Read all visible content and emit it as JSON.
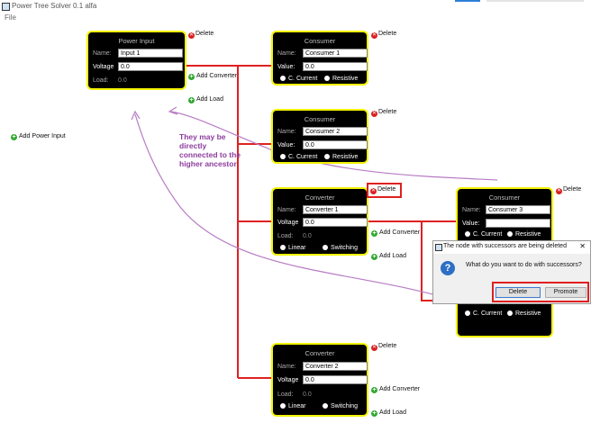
{
  "window": {
    "title": "Power Tree Solver 0.1 alfa"
  },
  "menu": {
    "file": "File"
  },
  "left": {
    "add_power_input": "Add Power Input"
  },
  "power_input": {
    "title": "Power Input",
    "name_label": "Name:",
    "name_value": "Input 1",
    "voltage_label": "Voltage",
    "voltage_value": "0.0",
    "load_label": "Load:",
    "load_value": "0.0",
    "delete": "Delete",
    "add_converter": "Add Converter",
    "add_load": "Add Load"
  },
  "consumer1": {
    "title": "Consumer",
    "name_label": "Name:",
    "name_value": "Consumer 1",
    "value_label": "Value:",
    "value_value": "0.0",
    "opt1": "C. Current",
    "opt2": "Resistive",
    "delete": "Delete"
  },
  "consumer2": {
    "title": "Consumer",
    "name_label": "Name:",
    "name_value": "Consumer 2",
    "value_label": "Value:",
    "value_value": "0.0",
    "opt1": "C. Current",
    "opt2": "Resistive",
    "delete": "Delete"
  },
  "converter1": {
    "title": "Converter",
    "name_label": "Name:",
    "name_value": "Converter 1",
    "voltage_label": "Voltage",
    "voltage_value": "0.0",
    "load_label": "Load:",
    "load_value": "0.0",
    "opt1": "Linear",
    "opt2": "Switching",
    "delete": "Delete",
    "add_converter": "Add Converter",
    "add_load": "Add Load"
  },
  "consumer3": {
    "title": "Consumer",
    "name_label": "Name:",
    "name_value": "Consumer 3",
    "value_label": "Value:",
    "value_value": "",
    "opt1": "C. Current",
    "opt2": "Resistive",
    "delete": "Delete"
  },
  "converter2": {
    "title": "Converter",
    "name_label": "Name:",
    "name_value": "Converter 2",
    "voltage_label": "Voltage",
    "voltage_value": "0.0",
    "load_label": "Load:",
    "load_value": "0.0",
    "opt1": "Linear",
    "opt2": "Switching",
    "delete": "Delete",
    "add_converter": "Add Converter",
    "add_load": "Add Load"
  },
  "annotation": {
    "text": "They may be directly connected to the higher ancestor"
  },
  "dialog": {
    "title": "The node with successors are being deleted",
    "close": "✕",
    "question_icon": "?",
    "message": "What do you want to do with successors?",
    "delete_button": "Delete",
    "promote_button": "Promote"
  },
  "colors": {
    "node_bg": "#000000",
    "node_border": "#f2f200",
    "wire": "#e02020",
    "annotation": "#8e3c9e",
    "delete_icon": "#d72020",
    "add_icon": "#2fa82f"
  }
}
